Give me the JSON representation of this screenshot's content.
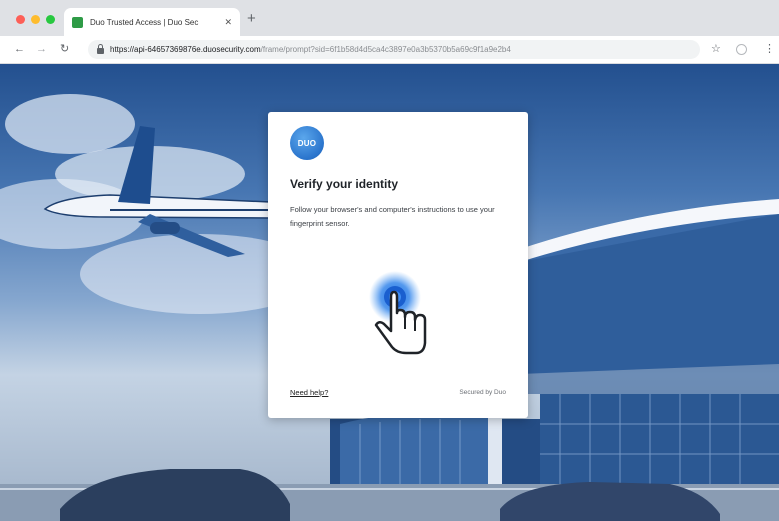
{
  "browser": {
    "tab": {
      "title": "Duo Trusted Access | Duo Sec",
      "close_icon": "close-icon",
      "favicon": "duo-favicon"
    },
    "new_tab_icon": "plus-icon",
    "toolbar": {
      "back_icon": "arrow-left-icon",
      "forward_icon": "arrow-right-icon",
      "reload_icon": "reload-icon",
      "url_host": "https://api-64657369876e.duosecurity.com",
      "url_path": "/frame/prompt?sid=6f1b58d4d5ca4c3897e0a3b5370b5a69c9f1a9e2b4",
      "bookmark_icon": "star-icon",
      "extension_icon": "extension-icon",
      "menu_icon": "kebab-menu-icon"
    }
  },
  "prompt": {
    "logo_text": "DUO",
    "heading": "Verify your identity",
    "instructions": "Follow your browser's and computer's instructions to use your fingerprint sensor.",
    "help_link": "Need help?",
    "secured_by": "Secured by Duo",
    "visual_icon": "fingerprint-touch-hand-icon"
  },
  "colors": {
    "duo_blue": "#2a74cc",
    "background_tint": "#23508f"
  }
}
